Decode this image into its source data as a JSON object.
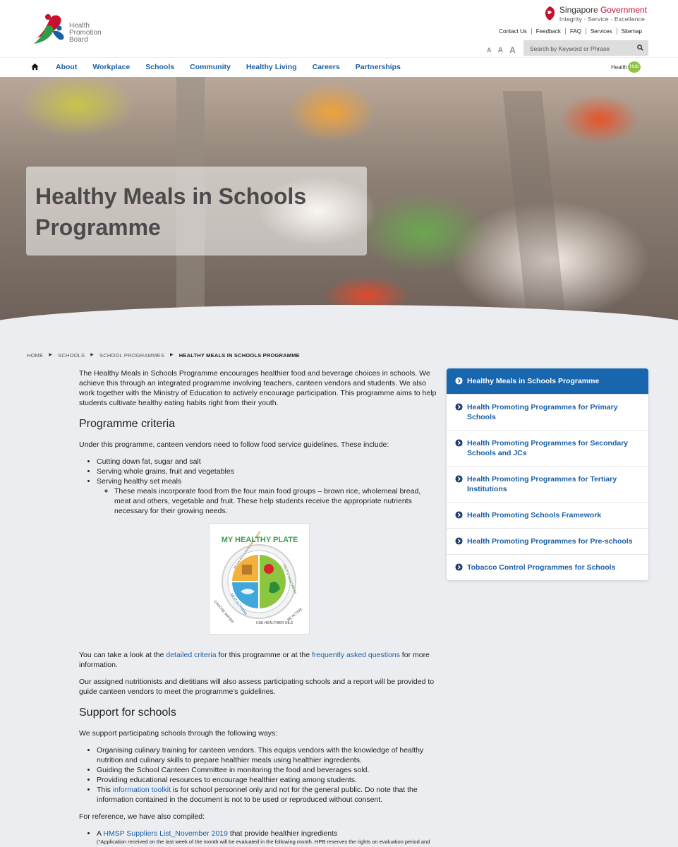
{
  "header": {
    "logo_text": [
      "Health",
      "Promotion",
      "Board"
    ],
    "sg_brand_name": "Singapore",
    "sg_brand_gov": "Government",
    "sg_tagline": "Integrity · Service · Excellence",
    "utility_links": [
      "Contact Us",
      "Feedback",
      "FAQ",
      "Services",
      "Sitemap"
    ],
    "font_size_labels": [
      "A",
      "A",
      "A"
    ],
    "search_placeholder": "Search by Keyword or Phrase"
  },
  "nav": {
    "items": [
      "About",
      "Workplace",
      "Schools",
      "Community",
      "Healthy Living",
      "Careers",
      "Partnerships"
    ],
    "healthhub_text": "Health",
    "healthhub_badge": "Hub"
  },
  "hero": {
    "title_line1": "Healthy Meals in Schools",
    "title_line2": "Programme"
  },
  "breadcrumb": [
    "Home",
    "Schools",
    "School Programmes",
    "Healthy Meals in Schools Programme"
  ],
  "content": {
    "intro": "The Healthy Meals in Schools Programme encourages healthier food and beverage choices in schools. We achieve this through an integrated programme involving teachers, canteen vendors and students. We also work together with the Ministry of Education to actively encourage participation. This programme aims to help students cultivate healthy eating habits right from their youth.",
    "criteria_heading": "Programme criteria",
    "criteria_lead": "Under this programme, canteen vendors need to follow food service guidelines. These include:",
    "criteria_list": [
      "Cutting down fat, sugar and salt",
      "Serving whole grains, fruit and vegetables",
      "Serving healthy set meals"
    ],
    "criteria_sub": "These meals incorporate food from the four main food groups – brown rice, wholemeal bread, meat and others, vegetable and fruit. These help students receive the appropriate nutrients necessary for their growing needs.",
    "plate_title": "MY HEALTHY PLATE",
    "plate_labels": [
      "BROWN RICE & WHOLEMEAL BREAD",
      "FRUIT & VEGETABLES",
      "MEAT & OTHERS",
      "CHOOSE WATER",
      "USE HEALTHIER OILS",
      "BE ACTIVE"
    ],
    "criteria_more_pre": "You can take a look at the ",
    "criteria_more_link1": "detailed criteria",
    "criteria_more_mid": " for this programme or at the ",
    "criteria_more_link2": "frequently asked questions",
    "criteria_more_post": " for more information.",
    "assess": "Our assigned nutritionists and dietitians will also assess participating schools and a report will be provided to guide canteen vendors to meet the programme's guidelines.",
    "support_heading": "Support for schools",
    "support_lead": "We support participating schools through the following ways:",
    "support_list": [
      "Organising culinary training for canteen vendors. This equips vendors with the knowledge of healthy nutrition and culinary skills to prepare healthier meals using healthier ingredients.",
      "Guiding the School Canteen Committee in monitoring the food and beverages sold.",
      "Providing educational resources to encourage healthier eating among students."
    ],
    "support_toolkit_pre": "This ",
    "support_toolkit_link": "information toolkit",
    "support_toolkit_post": " is for school personnel only and not for the general public. Do note that the information contained in the document is not to be used or reproduced without consent.",
    "reference_lead": "For reference, we have also compiled:",
    "reference_pre": "A ",
    "reference_link": "HMSP Suppliers List_November 2019",
    "reference_post": " that provide healthier ingredients",
    "reference_note": "(*Application received on the last week of the month will be evaluated in the following month. HPB reserves the rights on evaluation period and"
  },
  "sidebar": {
    "items": [
      "Healthy Meals in Schools Programme",
      "Health Promoting Programmes for Primary Schools",
      "Health Promoting Programmes for Secondary Schools and JCs",
      "Health Promoting Programmes for Tertiary Institutions",
      "Health Promoting Schools Framework",
      "Health Promoting Programmes for Pre-schools",
      "Tobacco Control Programmes for Schools"
    ]
  },
  "colors": {
    "nav_link": "#1a5fa6",
    "sidebar_active": "#1766ae",
    "sg_red": "#c8102e",
    "page_bg": "#ecedf0"
  },
  "icons": [
    "home-icon",
    "search-icon",
    "chevron-circle-right-icon",
    "hpb-logo-icon",
    "sg-lion-icon"
  ]
}
